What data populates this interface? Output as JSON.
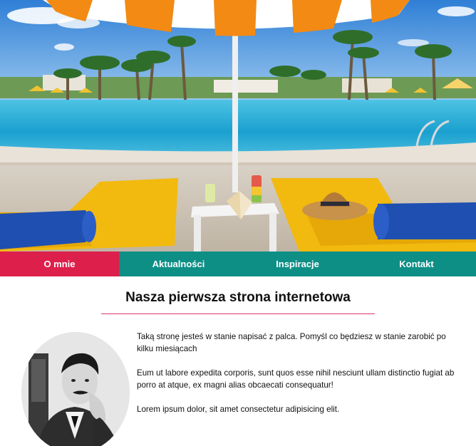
{
  "nav": {
    "items": [
      {
        "label": "O mnie",
        "active": true
      },
      {
        "label": "Aktualności",
        "active": false
      },
      {
        "label": "Inspiracje",
        "active": false
      },
      {
        "label": "Kontakt",
        "active": false
      }
    ]
  },
  "content": {
    "title": "Nasza pierwsza strona internetowa",
    "paragraphs": [
      "Taką stronę jesteś w stanie napisać z palca. Pomyśl co będziesz w stanie zarobić po kilku miesiącach",
      "Eum ut labore expedita corporis, sunt quos esse nihil nesciunt ullam distinctio fugiat ab porro at atque, ex magni alias obcaecati consequatur!",
      "Lorem ipsum dolor, sit amet consectetur adipisicing elit."
    ]
  },
  "images": {
    "hero": "resort-pool-photo",
    "portrait": "black-and-white-portrait-photo"
  },
  "colors": {
    "nav_active": "#dd1f4b",
    "nav_default": "#0e8f86",
    "title_rule": "#d9386a"
  }
}
